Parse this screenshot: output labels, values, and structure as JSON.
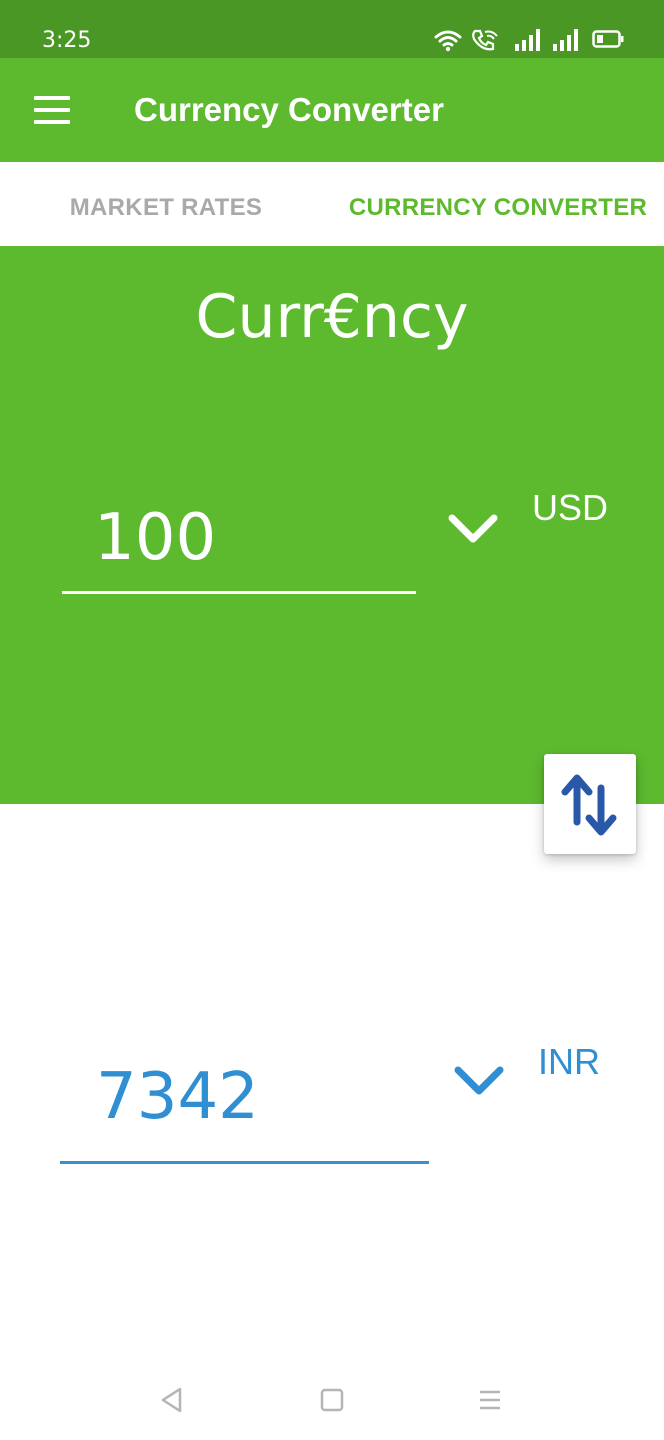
{
  "status_bar": {
    "time": "3:25",
    "icons": [
      "wifi-icon",
      "wifi-calling-icon",
      "signal-icon",
      "signal-icon",
      "battery-icon"
    ]
  },
  "app_bar": {
    "title": "Currency Converter",
    "menu_icon": "hamburger-menu-icon"
  },
  "tabs": [
    {
      "label": "MARKET RATES",
      "selected": false
    },
    {
      "label": "CURRENCY CONVERTER",
      "selected": true
    }
  ],
  "converter": {
    "logo_text": "Curr€ncy",
    "from": {
      "amount": "100",
      "currency": "USD"
    },
    "to": {
      "amount": "7342",
      "currency": "INR"
    },
    "swap_icon": "swap-vertical-icon",
    "dropdown_icon": "chevron-down-icon"
  },
  "nav_bar": {
    "icons": [
      "back-icon",
      "home-icon",
      "recents-icon"
    ]
  },
  "colors": {
    "primary": "#5dba2f",
    "status_bar": "#4a9726",
    "accent_blue": "#2f8fd2",
    "swap_icon": "#2a58a8",
    "tab_inactive": "#a9a9a9"
  }
}
